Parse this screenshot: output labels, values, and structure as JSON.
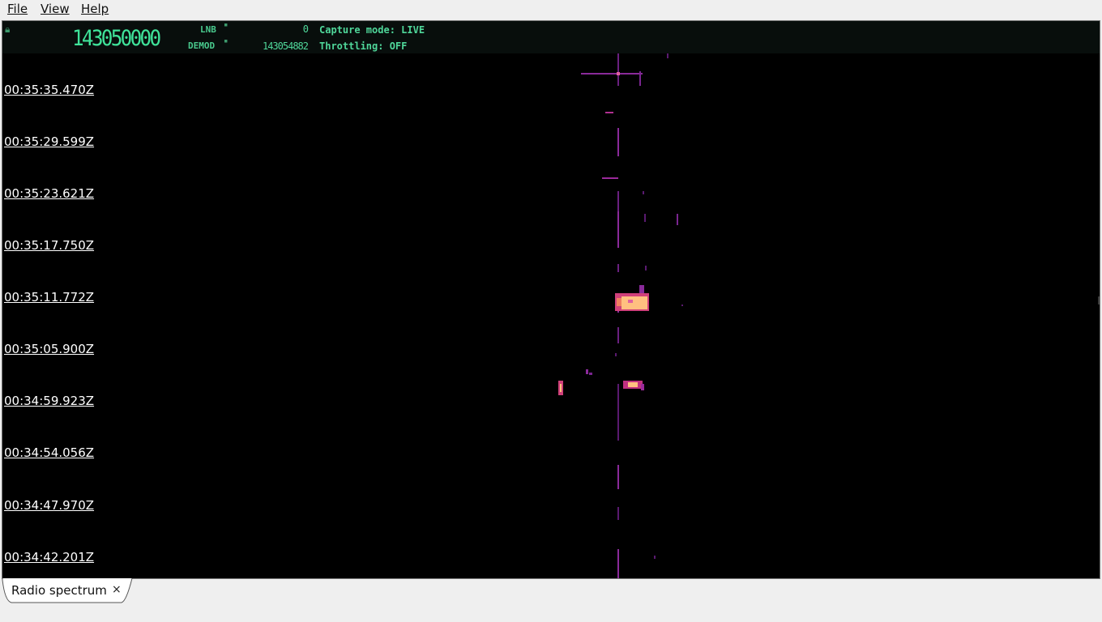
{
  "menu": {
    "file": "File",
    "view": "View",
    "help": "Help"
  },
  "status": {
    "center_frequency": "143050000",
    "lnb_label": "LNB",
    "lnb_value": "0",
    "demod_label": "DEMOD",
    "demod_value": "143054882",
    "capture_mode": "Capture mode: LIVE",
    "throttling": "Throttling: OFF"
  },
  "timestamps": [
    "00:35:35.470Z",
    "00:35:29.599Z",
    "00:35:23.621Z",
    "00:35:17.750Z",
    "00:35:11.772Z",
    "00:35:05.900Z",
    "00:34:59.923Z",
    "00:34:54.056Z",
    "00:34:47.970Z",
    "00:34:42.201Z"
  ],
  "tab": {
    "label": "Radio spectrum",
    "close": "×"
  },
  "colors": {
    "waterfall_bg": "#000000",
    "signal_low": "#8a2a9a",
    "signal_mid": "#d0407a",
    "signal_high": "#ffc080",
    "lcd_green": "#4fd79a"
  }
}
